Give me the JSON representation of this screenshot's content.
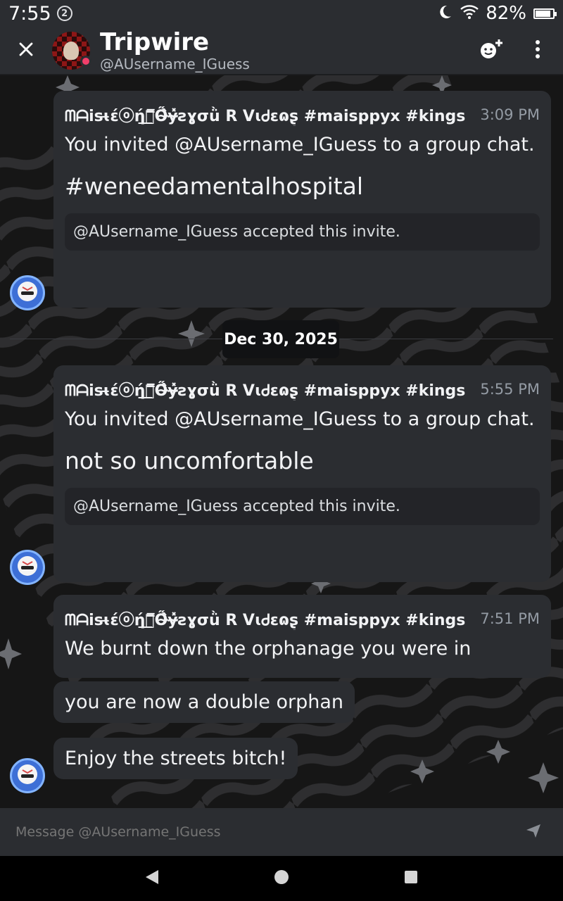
{
  "status_bar": {
    "time": "7:55",
    "notification_count": "2",
    "battery": "82%",
    "battery_level": 0.82
  },
  "header": {
    "name": "Tripwire",
    "handle": "@AUsername_IGuess",
    "icons": [
      "close-icon",
      "add-friend-icon",
      "more-icon"
    ]
  },
  "messages": [
    {
      "author": "ᗰᗩisɩ̶ɛ́ⓞή͟Ⓓ̿Ő̴̂ɏ̴̽ꙅɣσǜ R VɩᏧɛɷʂ̦ #maisppyx #kings",
      "time": "3:09 PM",
      "text": "You invited @AUsername_IGuess to a group chat.",
      "big_text": "#weneedamentalhospital",
      "invite": "@AUsername_IGuess accepted this invite."
    },
    {
      "author": "ᗰᗩisɩ̶ɛ́ⓞή͟Ⓓ̿Ő̴̂ɏ̴̽ꙅɣσǜ R VɩᏧɛɷʂ̦ #maisppyx #kings",
      "time": "5:55 PM",
      "text": "You invited @AUsername_IGuess to a group chat.",
      "big_text": "not so uncomfortable",
      "invite": "@AUsername_IGuess accepted this invite."
    },
    {
      "author": "ᗰᗩisɩ̶ɛ́ⓞή͟Ⓓ̿Ő̴̂ɏ̴̽ꙅɣσǜ R VɩᏧɛɷʂ̦ #maisppyx #kings",
      "time": "7:51 PM",
      "text": "We burnt down the orphanage you were in",
      "followups": [
        "you are now a double orphan",
        "Enjoy the streets bitch!"
      ]
    }
  ],
  "date_divider": "Dec 30, 2025",
  "composer": {
    "placeholder": "Message @AUsername_IGuess"
  },
  "colors": {
    "header_bg": "#2b2d31",
    "message_bg": "#2b2d31",
    "invite_bg": "#232428",
    "online": "#f23f6a",
    "avatar_blue": "#3d6fd6"
  }
}
